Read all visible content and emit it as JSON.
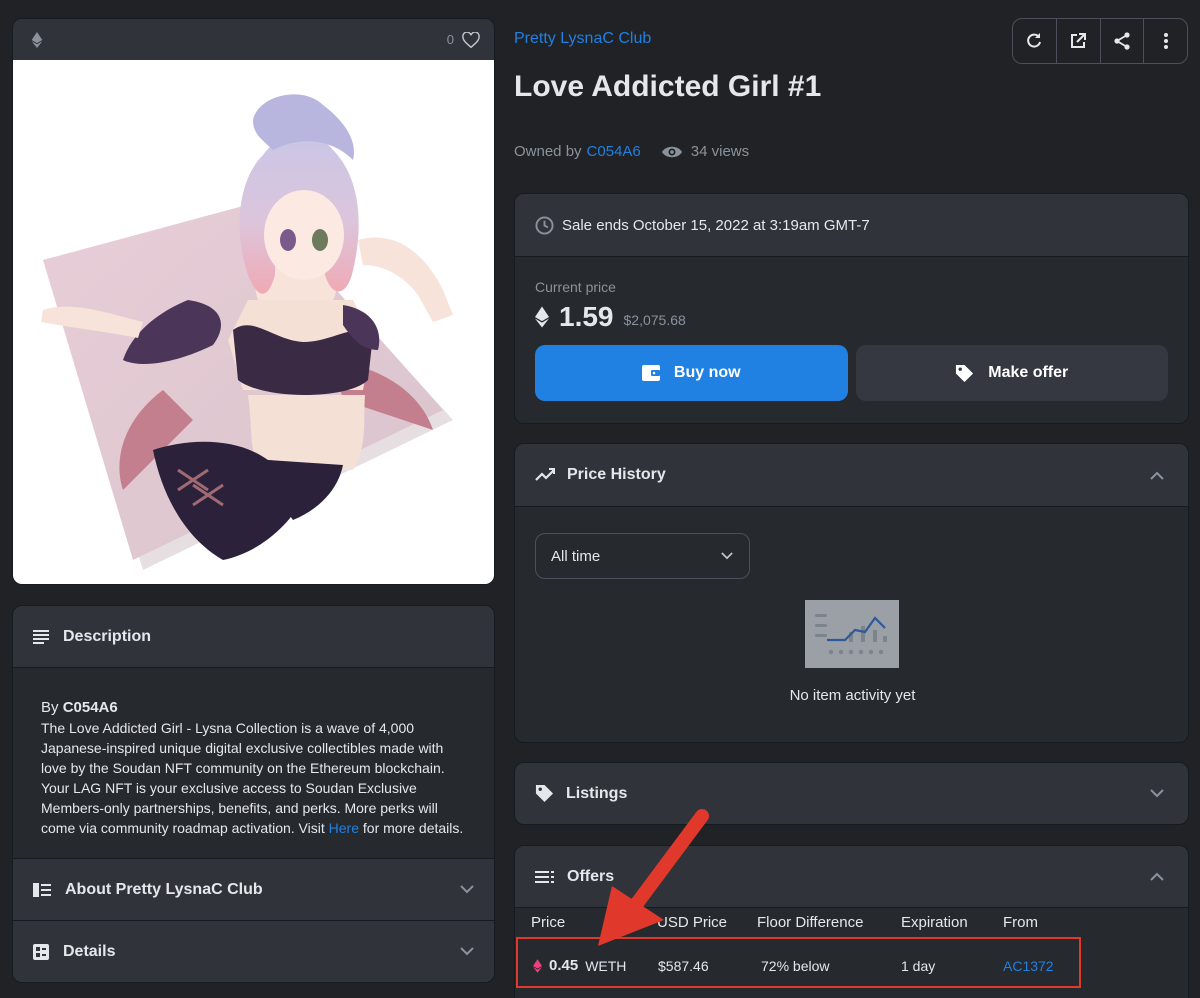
{
  "image_card": {
    "favorite_count": "0"
  },
  "description": {
    "title": "Description",
    "by_prefix": "By",
    "creator": "C054A6",
    "text": "The Love Addicted Girl - Lysna Collection is a wave of 4,000 Japanese-inspired unique digital exclusive collectibles made with love by the Soudan NFT community on the Ethereum blockchain. Your LAG NFT is your exclusive access to Soudan Exclusive Members-only partnerships, benefits, and perks. More perks will come via community roadmap activation. Visit",
    "link_text": "Here",
    "suffix": "for more details.",
    "about_title": "About Pretty LysnaC Club",
    "details_title": "Details"
  },
  "header": {
    "collection": "Pretty LysnaC Club",
    "title": "Love Addicted Girl #1",
    "owned_by_label": "Owned by",
    "owner": "C054A6",
    "views": "34 views"
  },
  "toolbar": {
    "icons": [
      "refresh-icon",
      "external-link-icon",
      "share-icon",
      "more-icon"
    ]
  },
  "sale": {
    "ends": "Sale ends October 15, 2022 at 3:19am GMT-7",
    "current_price_label": "Current price",
    "price": "1.59",
    "usd": "$2,075.68",
    "buy_label": "Buy now",
    "offer_label": "Make offer"
  },
  "price_history": {
    "title": "Price History",
    "range": "All time",
    "empty": "No item activity yet"
  },
  "listings": {
    "title": "Listings"
  },
  "offers": {
    "title": "Offers",
    "columns": [
      "Price",
      "USD Price",
      "Floor Difference",
      "Expiration",
      "From"
    ],
    "rows": [
      {
        "price": "0.45",
        "currency": "WETH",
        "usd": "$587.46",
        "floor": "72% below",
        "expiration": "1 day",
        "from": "AC1372"
      }
    ]
  },
  "colors": {
    "accent": "#2081e2",
    "highlight": "#e0392b",
    "weth": "#ec407a"
  }
}
